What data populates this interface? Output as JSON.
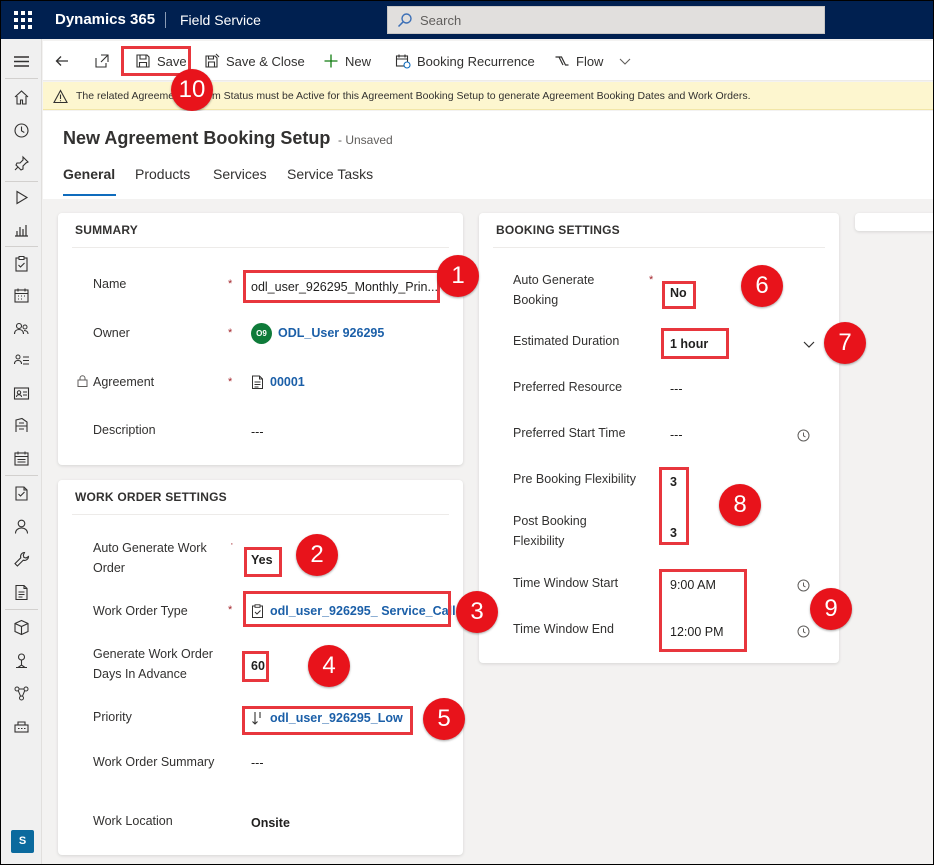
{
  "topbar": {
    "app_name": "Dynamics 365",
    "module_name": "Field Service",
    "search_placeholder": "Search"
  },
  "nav": {
    "icons": [
      "menu-icon",
      "home-icon",
      "recent-icon",
      "pin-icon",
      "play-icon",
      "dashboard-icon",
      "agreement-icon",
      "calendar-icon",
      "resources-icon",
      "list-icon",
      "contact-card-icon",
      "work-order-icon",
      "schedule-icon",
      "booking-icon",
      "person-icon",
      "wrench-icon",
      "report-icon",
      "inventory-icon",
      "location-pin-icon",
      "network-icon",
      "settings-panel-icon"
    ],
    "area_initial": "S"
  },
  "commands": {
    "save": "Save",
    "save_close": "Save & Close",
    "new": "New",
    "recurrence": "Booking Recurrence",
    "flow": "Flow"
  },
  "warning": {
    "text": "The related Agreement System Status must be Active for this Agreement Booking Setup to generate Agreement Booking Dates and Work Orders."
  },
  "record": {
    "title": "New Agreement Booking Setup",
    "status": "- Unsaved"
  },
  "tabs": [
    {
      "label": "General"
    },
    {
      "label": "Products"
    },
    {
      "label": "Services"
    },
    {
      "label": "Service Tasks"
    }
  ],
  "summary": {
    "title": "SUMMARY",
    "name_label": "Name",
    "name_value": "odl_user_926295_Monthly_Prin...",
    "owner_label": "Owner",
    "owner_initials": "O9",
    "owner_value": "ODL_User 926295",
    "agreement_label": "Agreement",
    "agreement_value": "00001",
    "description_label": "Description",
    "description_value": "---"
  },
  "work_order": {
    "title": "WORK ORDER SETTINGS",
    "auto_gen_label": "Auto Generate Work Order",
    "auto_gen_value": "Yes",
    "type_label": "Work Order Type",
    "type_value": "odl_user_926295_ Service_Call",
    "days_label": "Generate Work Order Days In Advance",
    "days_value": "60",
    "priority_label": "Priority",
    "priority_value": "odl_user_926295_Low",
    "summary_label": "Work Order Summary",
    "summary_value": "---",
    "location_label": "Work Location",
    "location_value": "Onsite"
  },
  "booking": {
    "title": "BOOKING SETTINGS",
    "auto_gen_label": "Auto Generate Booking",
    "auto_gen_value": "No",
    "duration_label": "Estimated Duration",
    "duration_value": "1 hour",
    "pref_resource_label": "Preferred Resource",
    "pref_resource_value": "---",
    "pref_start_label": "Preferred Start Time",
    "pref_start_value": "---",
    "pre_flex_label": "Pre Booking Flexibility",
    "pre_flex_value": "3",
    "post_flex_label": "Post Booking Flexibility",
    "post_flex_value": "3",
    "tw_start_label": "Time Window Start",
    "tw_start_value": "9:00 AM",
    "tw_end_label": "Time Window End",
    "tw_end_value": "12:00 PM"
  },
  "callouts": [
    "1",
    "2",
    "3",
    "4",
    "5",
    "6",
    "7",
    "8",
    "9",
    "10"
  ],
  "required_marker": "*",
  "colors": {
    "topbar": "#002050",
    "callout": "#e8131b",
    "highlight": "#e8363d",
    "link": "#1b5fa8",
    "owner_persona": "#0f7b3a"
  }
}
